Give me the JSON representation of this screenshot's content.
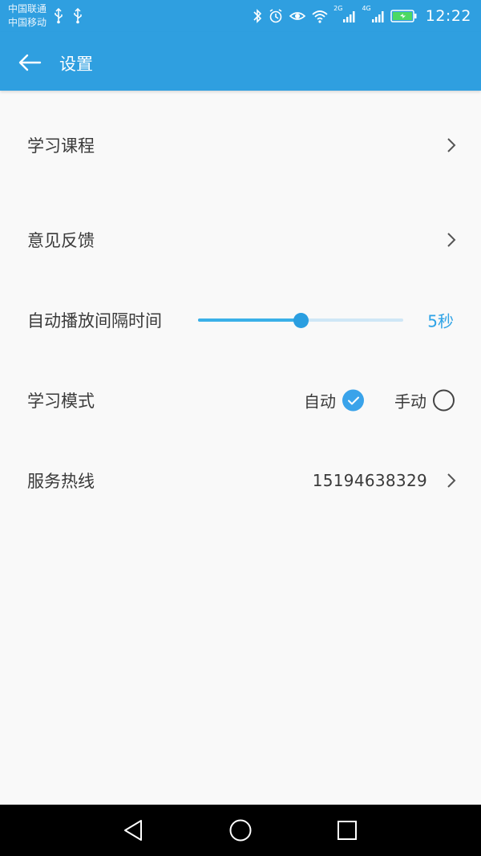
{
  "status_bar": {
    "carrier_1": "中国联通",
    "carrier_2": "中国移动",
    "network_2g": "2G",
    "network_4g": "4G",
    "time": "12:22"
  },
  "app_bar": {
    "title": "设置"
  },
  "settings": {
    "course": {
      "label": "学习课程"
    },
    "feedback": {
      "label": "意见反馈"
    },
    "autoplay": {
      "label": "自动播放间隔时间",
      "value_text": "5秒",
      "level_percent": 50
    },
    "mode": {
      "label": "学习模式",
      "options": [
        {
          "label": "自动",
          "selected": true
        },
        {
          "label": "手动",
          "selected": false
        }
      ]
    },
    "hotline": {
      "label": "服务热线",
      "number": "15194638329"
    }
  },
  "colors": {
    "primary": "#2f9fe0",
    "accent": "#2ea3e6",
    "background": "#f9f9f9",
    "text": "#3a3a3a"
  },
  "icons": [
    "usb-icon",
    "bluetooth-icon",
    "alarm-icon",
    "eye-icon",
    "wifi-icon",
    "signal-icon",
    "battery-charging-icon",
    "back-arrow-icon",
    "chevron-right-icon",
    "check-icon",
    "nav-back-icon",
    "nav-home-icon",
    "nav-recent-icon"
  ]
}
